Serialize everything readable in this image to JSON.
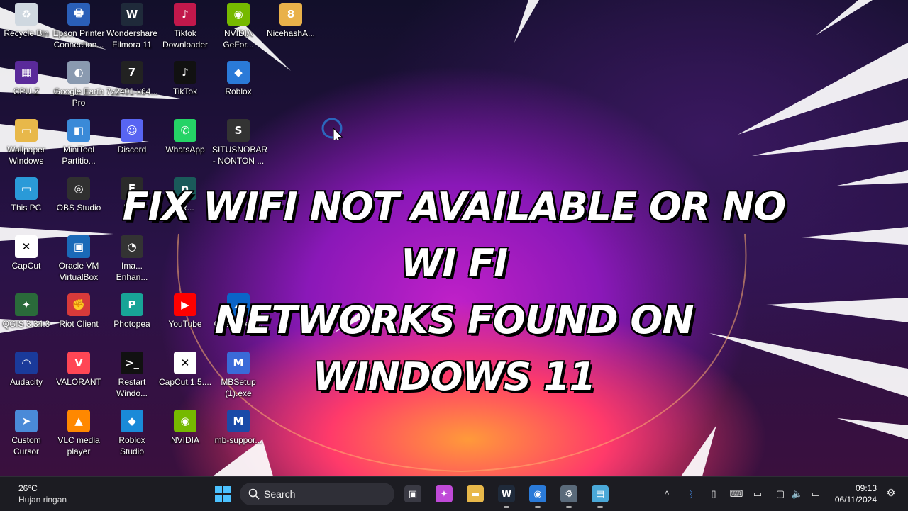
{
  "desktop": {
    "icons": [
      {
        "name": "recycle-bin",
        "label": "Recycle Bin",
        "col": 0,
        "row": 0,
        "bg": "#cfd8e0",
        "glyph": "♻"
      },
      {
        "name": "epson-printer",
        "label": "Epson Printer\nConnection...",
        "col": 1,
        "row": 0,
        "bg": "#2a5fb8",
        "glyph": "🖶"
      },
      {
        "name": "wondershare-filmora",
        "label": "Wondershare\nFilmora 11",
        "col": 2,
        "row": 0,
        "bg": "#1f2a3a",
        "glyph": "W"
      },
      {
        "name": "tiktok-downloader",
        "label": "Tiktok\nDownloader",
        "col": 3,
        "row": 0,
        "bg": "#c2184b",
        "glyph": "♪"
      },
      {
        "name": "nvidia-geforce",
        "label": "NVIDIA\nGeFor...",
        "col": 4,
        "row": 0,
        "bg": "#76b900",
        "glyph": "◉"
      },
      {
        "name": "nicehash",
        "label": "NicehashA...",
        "col": 5,
        "row": 0,
        "bg": "#e9b14a",
        "glyph": "8"
      },
      {
        "name": "cpu-z",
        "label": "CPU-Z",
        "col": 0,
        "row": 1,
        "bg": "#5a2a9a",
        "glyph": "▦"
      },
      {
        "name": "google-earth-pro",
        "label": "Google Earth\nPro",
        "col": 1,
        "row": 1,
        "bg": "#8a9ab0",
        "glyph": "◐"
      },
      {
        "name": "7zip",
        "label": "7z2401-x64...",
        "col": 2,
        "row": 1,
        "bg": "#222222",
        "glyph": "7"
      },
      {
        "name": "tiktok",
        "label": "TikTok",
        "col": 3,
        "row": 1,
        "bg": "#111111",
        "glyph": "♪"
      },
      {
        "name": "roblox",
        "label": "Roblox",
        "col": 4,
        "row": 1,
        "bg": "#2a7ad8",
        "glyph": "◆"
      },
      {
        "name": "wallpaper-windows",
        "label": "Wallpaper\nWindows",
        "col": 0,
        "row": 2,
        "bg": "#e8b84a",
        "glyph": "▭"
      },
      {
        "name": "minitool-partition",
        "label": "MiniTool\nPartitio...",
        "col": 1,
        "row": 2,
        "bg": "#3a8ad8",
        "glyph": "◧"
      },
      {
        "name": "discord",
        "label": "Discord",
        "col": 2,
        "row": 2,
        "bg": "#5865f2",
        "glyph": "☺"
      },
      {
        "name": "whatsapp",
        "label": "WhatsApp",
        "col": 3,
        "row": 2,
        "bg": "#25d366",
        "glyph": "✆"
      },
      {
        "name": "situsnobar",
        "label": "SITUSNOBAR\n- NONTON ...",
        "col": 4,
        "row": 2,
        "bg": "#333333",
        "glyph": "S"
      },
      {
        "name": "this-pc",
        "label": "This PC",
        "col": 0,
        "row": 3,
        "bg": "#2a9ad8",
        "glyph": "▭"
      },
      {
        "name": "obs-studio",
        "label": "OBS Studio",
        "col": 1,
        "row": 3,
        "bg": "#303030",
        "glyph": "◎"
      },
      {
        "name": "fo-app",
        "label": "Fo...",
        "col": 2,
        "row": 3,
        "bg": "#2a2a2a",
        "glyph": "F"
      },
      {
        "name": "nr-app",
        "label": "nR...",
        "col": 3,
        "row": 3,
        "bg": "#1a5a5a",
        "glyph": "n"
      },
      {
        "name": "capcut",
        "label": "CapCut",
        "col": 0,
        "row": 4,
        "bg": "#ffffff",
        "glyph": "✕",
        "fg": "#000"
      },
      {
        "name": "oracle-vm-virtualbox",
        "label": "Oracle VM\nVirtualBox",
        "col": 1,
        "row": 4,
        "bg": "#1a6ab8",
        "glyph": "▣"
      },
      {
        "name": "image-enhancer",
        "label": "Ima...\nEnhan...",
        "col": 2,
        "row": 4,
        "bg": "#333333",
        "glyph": "◔"
      },
      {
        "name": "qgis",
        "label": "QGIS 3.34.3",
        "col": 0,
        "row": 5,
        "bg": "#2a6a3a",
        "glyph": "✦"
      },
      {
        "name": "riot-client",
        "label": "Riot Client",
        "col": 1,
        "row": 5,
        "bg": "#d83a3a",
        "glyph": "✊"
      },
      {
        "name": "photopea",
        "label": "Photopea",
        "col": 2,
        "row": 5,
        "bg": "#18a497",
        "glyph": "P"
      },
      {
        "name": "youtube",
        "label": "YouTube",
        "col": 3,
        "row": 5,
        "bg": "#ff0000",
        "glyph": "▶"
      },
      {
        "name": "onedrive",
        "label": "OneDriveS...",
        "col": 4,
        "row": 5,
        "bg": "#0a64c8",
        "glyph": "☁"
      },
      {
        "name": "audacity",
        "label": "Audacity",
        "col": 0,
        "row": 6,
        "bg": "#1a3a9a",
        "glyph": "◠"
      },
      {
        "name": "valorant",
        "label": "VALORANT",
        "col": 1,
        "row": 6,
        "bg": "#ff4655",
        "glyph": "V"
      },
      {
        "name": "restart-windows",
        "label": "Restart\nWindo...",
        "col": 2,
        "row": 6,
        "bg": "#111111",
        "glyph": ">_"
      },
      {
        "name": "capcut-installer",
        "label": "CapCut.1.5....",
        "col": 3,
        "row": 6,
        "bg": "#ffffff",
        "glyph": "✕",
        "fg": "#000"
      },
      {
        "name": "mbsetup",
        "label": "MBSetup\n(1).exe",
        "col": 4,
        "row": 6,
        "bg": "#3a6ad8",
        "glyph": "M"
      },
      {
        "name": "custom-cursor",
        "label": "Custom\nCursor",
        "col": 0,
        "row": 7,
        "bg": "#4a8ad8",
        "glyph": "➤"
      },
      {
        "name": "vlc-media-player",
        "label": "VLC media\nplayer",
        "col": 1,
        "row": 7,
        "bg": "#ff8800",
        "glyph": "▲"
      },
      {
        "name": "roblox-studio",
        "label": "Roblox\nStudio",
        "col": 2,
        "row": 7,
        "bg": "#1a8ad8",
        "glyph": "◆"
      },
      {
        "name": "nvidia",
        "label": "NVIDIA",
        "col": 3,
        "row": 7,
        "bg": "#76b900",
        "glyph": "◉"
      },
      {
        "name": "mb-support",
        "label": "mb-suppor...",
        "col": 4,
        "row": 7,
        "bg": "#1a4aa8",
        "glyph": "M"
      }
    ]
  },
  "headline": {
    "line1": "FIX WIFI NOT AVAILABLE OR NO WI FI",
    "line2": "NETWORKS FOUND ON WINDOWS 11"
  },
  "taskbar": {
    "weather": {
      "temp": "26°C",
      "condition": "Hujan ringan"
    },
    "search_label": "Search",
    "apps": [
      {
        "name": "task-view",
        "glyph": "▣",
        "bg": "#3a3a44",
        "active": false
      },
      {
        "name": "copilot",
        "glyph": "✦",
        "bg": "#c04ad8",
        "active": false
      },
      {
        "name": "file-explorer",
        "glyph": "▬",
        "bg": "#e8b84a",
        "active": false
      },
      {
        "name": "filmora",
        "glyph": "W",
        "bg": "#1f2a3a",
        "active": true
      },
      {
        "name": "chrome",
        "glyph": "◉",
        "bg": "#2a7ad8",
        "active": true
      },
      {
        "name": "settings",
        "glyph": "⚙",
        "bg": "#5a6a7a",
        "active": true
      },
      {
        "name": "notepad",
        "glyph": "▤",
        "bg": "#4aa8d8",
        "active": true
      }
    ],
    "tray": [
      {
        "name": "show-hidden-icons",
        "glyph": "^"
      },
      {
        "name": "bluetooth",
        "glyph": "ᛒ"
      },
      {
        "name": "usb",
        "glyph": "▯"
      },
      {
        "name": "keyboard",
        "glyph": "⌨"
      },
      {
        "name": "display",
        "glyph": "▭"
      },
      {
        "name": "network",
        "glyph": "▢"
      },
      {
        "name": "volume",
        "glyph": "🔈"
      },
      {
        "name": "battery",
        "glyph": "▭"
      }
    ],
    "clock": {
      "time": "09:13",
      "date": "06/11/2024"
    }
  }
}
